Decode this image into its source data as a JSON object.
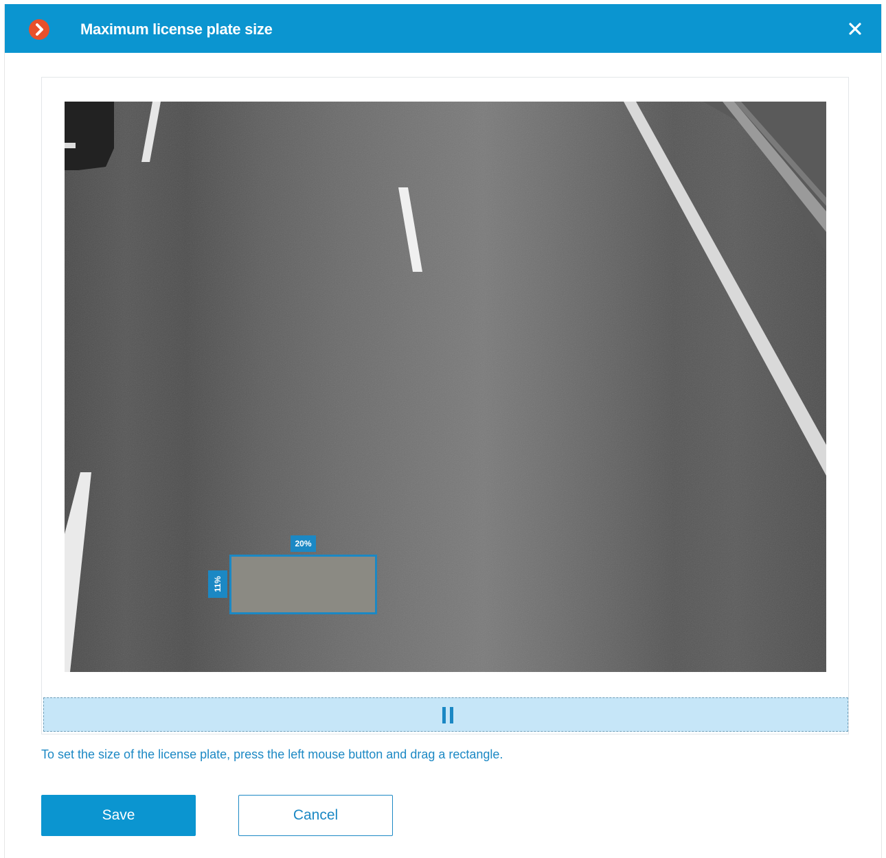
{
  "dialog": {
    "title": "Maximum license plate size",
    "icon": "chevron-right-icon",
    "close_icon": "close-icon"
  },
  "preview": {
    "plate_width_label": "20%",
    "plate_height_label": "11%",
    "plate_width_percent": 20,
    "plate_height_percent": 11
  },
  "hint": "To set the size of the license plate, press the left mouse button and drag a rectangle.",
  "buttons": {
    "save": "Save",
    "cancel": "Cancel"
  },
  "colors": {
    "accent": "#0b95d0",
    "icon_accent": "#e8502b"
  }
}
